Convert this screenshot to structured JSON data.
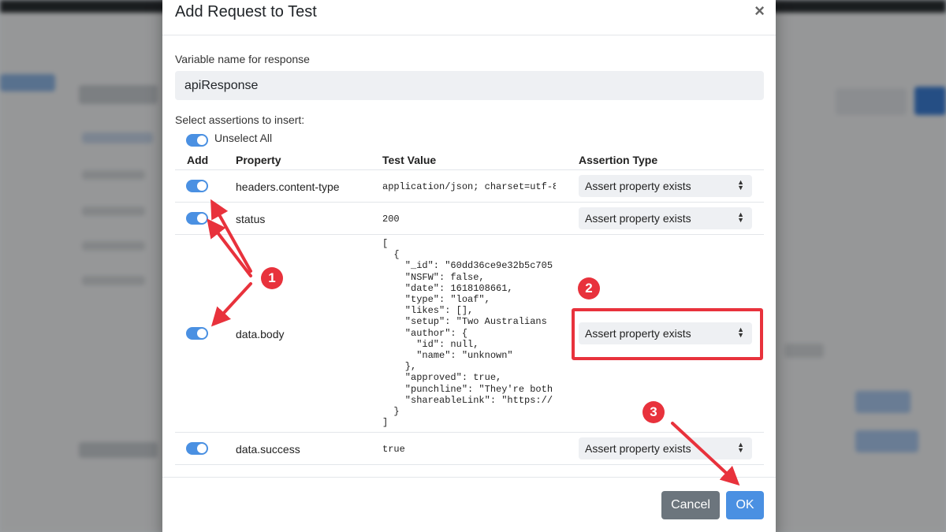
{
  "modal": {
    "title": "Add Request to Test",
    "close_symbol": "×",
    "variable_label": "Variable name for response",
    "variable_value": "apiResponse",
    "assertions_label": "Select assertions to insert:",
    "unselect_all_label": "Unselect All",
    "unselect_all_checked": true,
    "table": {
      "headers": [
        "Add",
        "Property",
        "Test Value",
        "Assertion Type"
      ],
      "rows": [
        {
          "enabled": true,
          "property": "headers.content-type",
          "test_value": "application/json; charset=utf-8",
          "assertion_type": "Assert property exists"
        },
        {
          "enabled": true,
          "property": "status",
          "test_value": "200",
          "assertion_type": "Assert property exists"
        },
        {
          "enabled": true,
          "property": "data.body",
          "test_value": "[\n  {\n    \"_id\": \"60dd36ce9e32b5c705\n    \"NSFW\": false,\n    \"date\": 1618108661,\n    \"type\": \"loaf\",\n    \"likes\": [],\n    \"setup\": \"Two Australians\n    \"author\": {\n      \"id\": null,\n      \"name\": \"unknown\"\n    },\n    \"approved\": true,\n    \"punchline\": \"They're both\n    \"shareableLink\": \"https://\n  }\n]",
          "assertion_type": "Assert property exists"
        },
        {
          "enabled": true,
          "property": "data.success",
          "test_value": "true",
          "assertion_type": "Assert property exists"
        }
      ]
    },
    "buttons": {
      "cancel": "Cancel",
      "ok": "OK"
    }
  },
  "annotations": {
    "badges": [
      "1",
      "2",
      "3"
    ],
    "color": "#e8323c"
  },
  "colors": {
    "accent": "#4a90e2",
    "cancel": "#6c757d",
    "annotation": "#e8323c"
  },
  "icons": [
    "close-icon",
    "select-caret-icon",
    "arrow-icon"
  ]
}
